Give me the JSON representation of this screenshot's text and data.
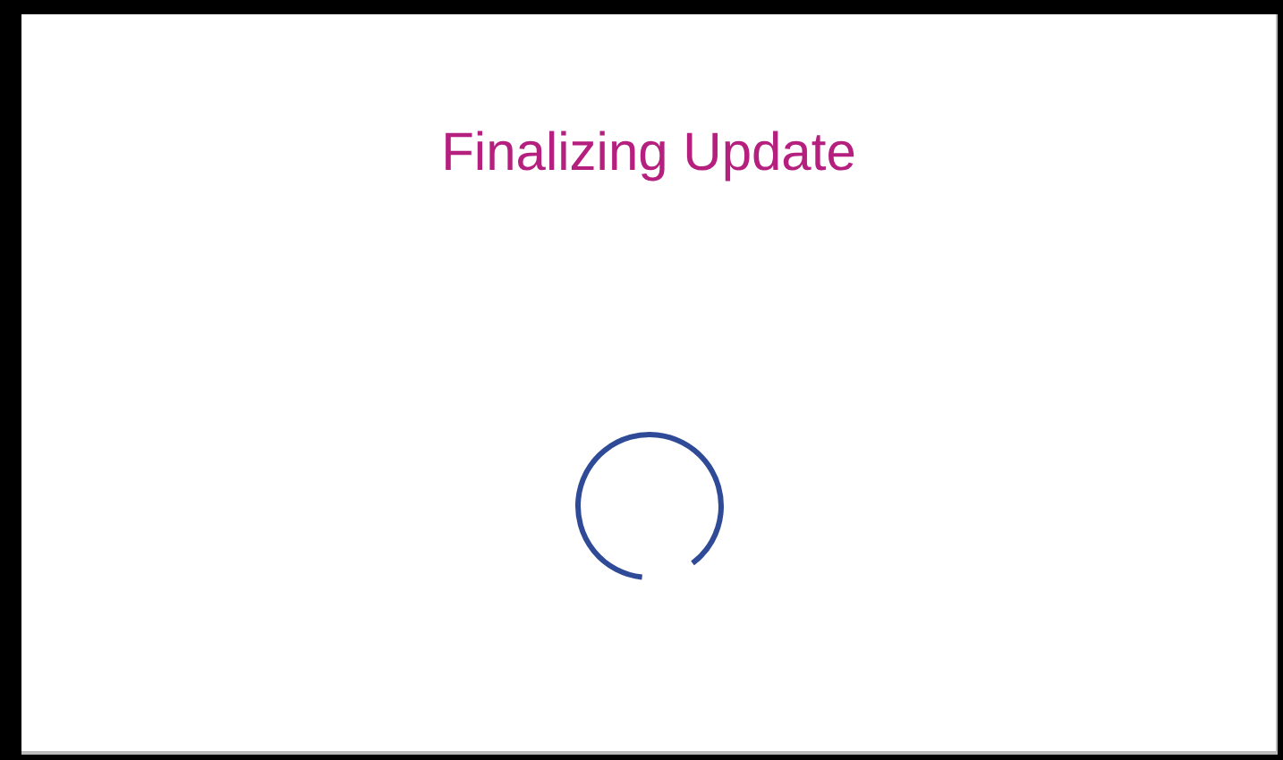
{
  "title": "Finalizing Update"
}
